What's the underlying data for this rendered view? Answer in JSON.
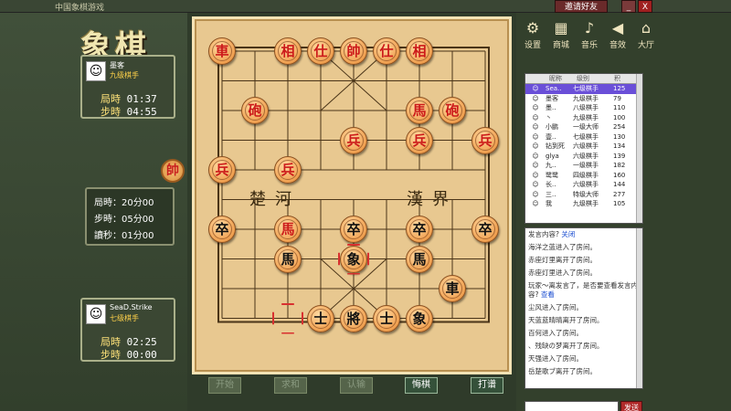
{
  "titlebar": {
    "text": "中国象棋游戏",
    "invite_label": "邀请好友",
    "minimize_label": "_",
    "close_label": "X"
  },
  "logo": "象棋",
  "top_player": {
    "name": "墨客",
    "rank": "九级棋手",
    "game_time_label": "局時",
    "game_time": "01:37",
    "step_time_label": "步時",
    "step_time": "04:55"
  },
  "settings": {
    "game_time": "局時：20分00",
    "step_time": "步時：05分00",
    "countdown": "讀秒：01分00"
  },
  "bottom_player": {
    "name": "SeaD.Strike",
    "rank": "七级棋手",
    "game_time_label": "局時",
    "game_time": "02:25",
    "step_time_label": "步時",
    "step_time": "00:00"
  },
  "side_piece": "帥",
  "river": {
    "left": "楚河",
    "right": "漢界"
  },
  "pieces": [
    {
      "t": "車",
      "c": "red",
      "col": 0,
      "row": 0
    },
    {
      "t": "相",
      "c": "red",
      "col": 2,
      "row": 0
    },
    {
      "t": "仕",
      "c": "red",
      "col": 3,
      "row": 0
    },
    {
      "t": "帥",
      "c": "red",
      "col": 4,
      "row": 0
    },
    {
      "t": "仕",
      "c": "red",
      "col": 5,
      "row": 0
    },
    {
      "t": "相",
      "c": "red",
      "col": 6,
      "row": 0
    },
    {
      "t": "砲",
      "c": "red",
      "col": 1,
      "row": 2
    },
    {
      "t": "馬",
      "c": "red",
      "col": 6,
      "row": 2
    },
    {
      "t": "砲",
      "c": "red",
      "col": 7,
      "row": 2
    },
    {
      "t": "兵",
      "c": "red",
      "col": 4,
      "row": 3
    },
    {
      "t": "兵",
      "c": "red",
      "col": 6,
      "row": 3
    },
    {
      "t": "兵",
      "c": "red",
      "col": 8,
      "row": 3
    },
    {
      "t": "兵",
      "c": "red",
      "col": 0,
      "row": 4
    },
    {
      "t": "兵",
      "c": "red",
      "col": 2,
      "row": 4
    },
    {
      "t": "卒",
      "c": "black",
      "col": 0,
      "row": 6
    },
    {
      "t": "馬",
      "c": "red",
      "col": 2,
      "row": 6
    },
    {
      "t": "卒",
      "c": "black",
      "col": 4,
      "row": 6
    },
    {
      "t": "卒",
      "c": "black",
      "col": 6,
      "row": 6
    },
    {
      "t": "卒",
      "c": "black",
      "col": 8,
      "row": 6
    },
    {
      "t": "馬",
      "c": "black",
      "col": 2,
      "row": 7
    },
    {
      "t": "象",
      "c": "black",
      "col": 4,
      "row": 7
    },
    {
      "t": "馬",
      "c": "black",
      "col": 6,
      "row": 7
    },
    {
      "t": "車",
      "c": "black",
      "col": 7,
      "row": 8
    },
    {
      "t": "士",
      "c": "black",
      "col": 3,
      "row": 9
    },
    {
      "t": "將",
      "c": "black",
      "col": 4,
      "row": 9
    },
    {
      "t": "士",
      "c": "black",
      "col": 5,
      "row": 9
    },
    {
      "t": "象",
      "c": "black",
      "col": 6,
      "row": 9
    }
  ],
  "selected": [
    {
      "col": 4,
      "row": 7
    },
    {
      "col": 2,
      "row": 9
    }
  ],
  "buttons": [
    {
      "label": "开始",
      "active": false
    },
    {
      "label": "求和",
      "active": false
    },
    {
      "label": "认输",
      "active": false
    },
    {
      "label": "悔棋",
      "active": true
    },
    {
      "label": "打谱",
      "active": true
    }
  ],
  "tools": [
    {
      "label": "设置",
      "icon": "⚙"
    },
    {
      "label": "商城",
      "icon": "▦"
    },
    {
      "label": "音乐",
      "icon": "♪"
    },
    {
      "label": "音效",
      "icon": "◀"
    },
    {
      "label": "大厅",
      "icon": "⌂"
    }
  ],
  "user_list": {
    "headers": [
      "昵称",
      "级别",
      "积"
    ],
    "rows": [
      {
        "name": "Sea..",
        "rank": "七级棋手",
        "score": "125",
        "sel": true
      },
      {
        "name": "墨客",
        "rank": "九级棋手",
        "score": "79"
      },
      {
        "name": "墨..",
        "rank": "八级棋手",
        "score": "110"
      },
      {
        "name": "丶",
        "rank": "九级棋手",
        "score": "100"
      },
      {
        "name": "小鹏",
        "rank": "一级大师",
        "score": "254"
      },
      {
        "name": "壹..",
        "rank": "七级棋手",
        "score": "130"
      },
      {
        "name": "钻到死",
        "rank": "六级棋手",
        "score": "134"
      },
      {
        "name": "glya",
        "rank": "六级棋手",
        "score": "139"
      },
      {
        "name": "九..",
        "rank": "一级棋手",
        "score": "182"
      },
      {
        "name": "鹭鹭",
        "rank": "四级棋手",
        "score": "160"
      },
      {
        "name": "长..",
        "rank": "六级棋手",
        "score": "144"
      },
      {
        "name": "三..",
        "rank": "特级大师",
        "score": "277"
      },
      {
        "name": "我",
        "rank": "九级棋手",
        "score": "105"
      }
    ]
  },
  "chat": [
    {
      "text": "发言内容? ",
      "link": "关闭"
    },
    {
      "text": "海洋之蓝进入了房间。"
    },
    {
      "text": "赤座灯里离开了房间。"
    },
    {
      "text": "赤座灯里进入了房间。"
    },
    {
      "text": "玩家～离发言了，是否要查看发言内容? ",
      "link": "查看"
    },
    {
      "text": "尘风进入了房间。"
    },
    {
      "text": "天蓝蓝晴晴离开了房间。"
    },
    {
      "text": "百何进入了房间。"
    },
    {
      "text": "、残缺の梦离开了房间。"
    },
    {
      "text": "天强进入了房间。"
    },
    {
      "text": "岳楚歌ブ离开了房间。"
    }
  ],
  "send_label": "发送"
}
